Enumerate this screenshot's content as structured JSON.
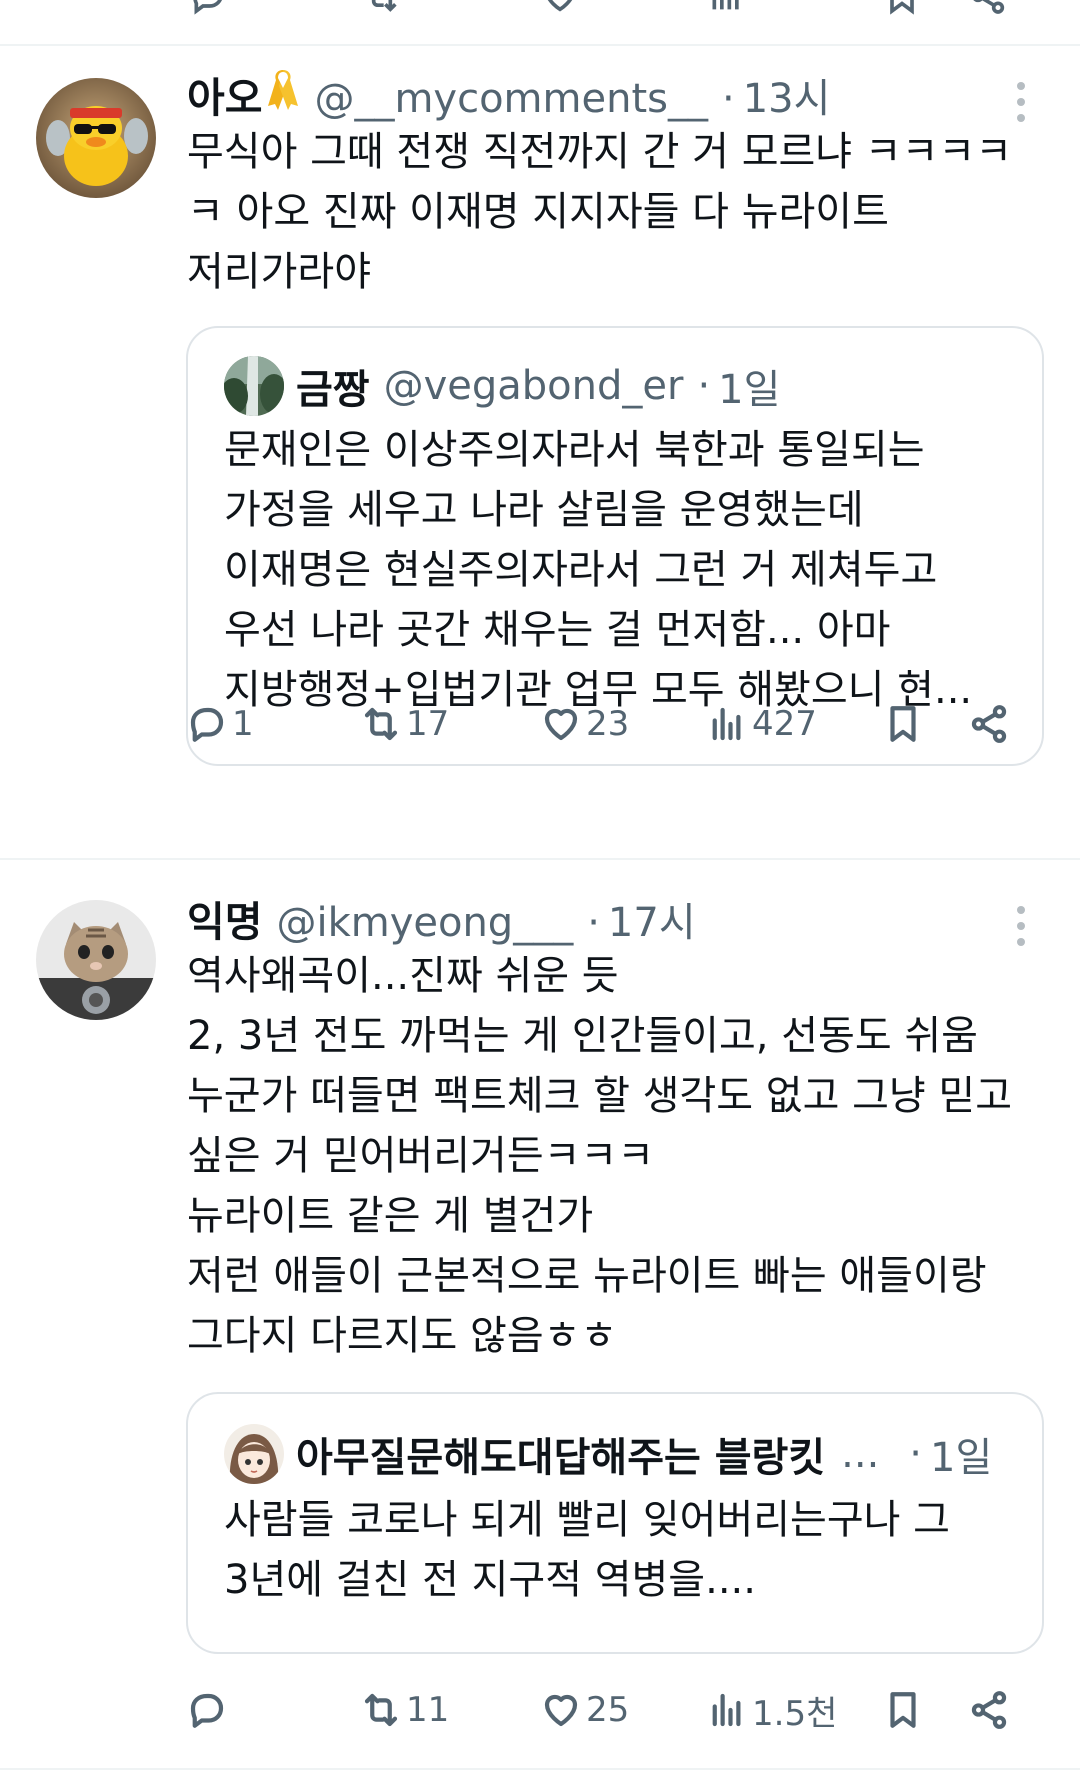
{
  "tweets": [
    {
      "name": "아오",
      "handle": "@__mycomments__",
      "dot": "·",
      "time": "13시",
      "text": "무식아 그때 전쟁 직전까지 간 거 모르냐 ㅋㅋㅋㅋ\nㅋ 아오 진짜 이재명 지지자들 다 뉴라이트\n저리가라야",
      "quote": {
        "name": "금짱",
        "handle": "@vegabond_er",
        "dot": "·",
        "time": "1일",
        "text": "문재인은 이상주의자라서 북한과 통일되는\n가정을 세우고 나라 살림을 운영했는데\n이재명은 현실주의자라서 그런 거 제쳐두고\n우선 나라 곳간 채우는 걸 먼저함... 아마\n지방행정+입법기관 업무 모두 해봤으니 현..."
      },
      "actions": {
        "replies": "1",
        "reposts": "17",
        "likes": "23",
        "views": "427"
      }
    },
    {
      "name": "익명",
      "handle": "@ikmyeong___",
      "dot": "·",
      "time": "17시",
      "text": "역사왜곡이...진짜 쉬운 듯\n2, 3년 전도 까먹는 게 인간들이고, 선동도 쉬움\n누군가 떠들면 팩트체크 할 생각도 없고 그냥 믿고\n싶은 거 믿어버리거든ㅋㅋㅋ\n뉴라이트 같은 게 별건가\n저런 애들이 근본적으로 뉴라이트 빠는 애들이랑\n그다지 다르지도 않음ㅎㅎ",
      "quote": {
        "name": "아무질문해도대답해주는 블랑킷",
        "ellipsis": "...",
        "dot": "·",
        "time": "1일",
        "text": "사람들 코로나 되게 빨리 잊어버리는구나 그\n3년에 걸친 전 지구적 역병을...."
      },
      "actions": {
        "replies": "",
        "reposts": "11",
        "likes": "25",
        "views": "1.5천"
      }
    }
  ],
  "icons": {
    "reply": "reply-icon",
    "repost": "repost-icon",
    "like": "heart-icon",
    "views": "views-icon",
    "bookmark": "bookmark-icon",
    "share": "share-icon",
    "more": "more-icon",
    "ribbon": "yellow-ribbon-icon"
  },
  "colors": {
    "text": "#0f1419",
    "secondary": "#536471",
    "divider": "#eff3f4",
    "ribbon": "#f2b21b"
  }
}
